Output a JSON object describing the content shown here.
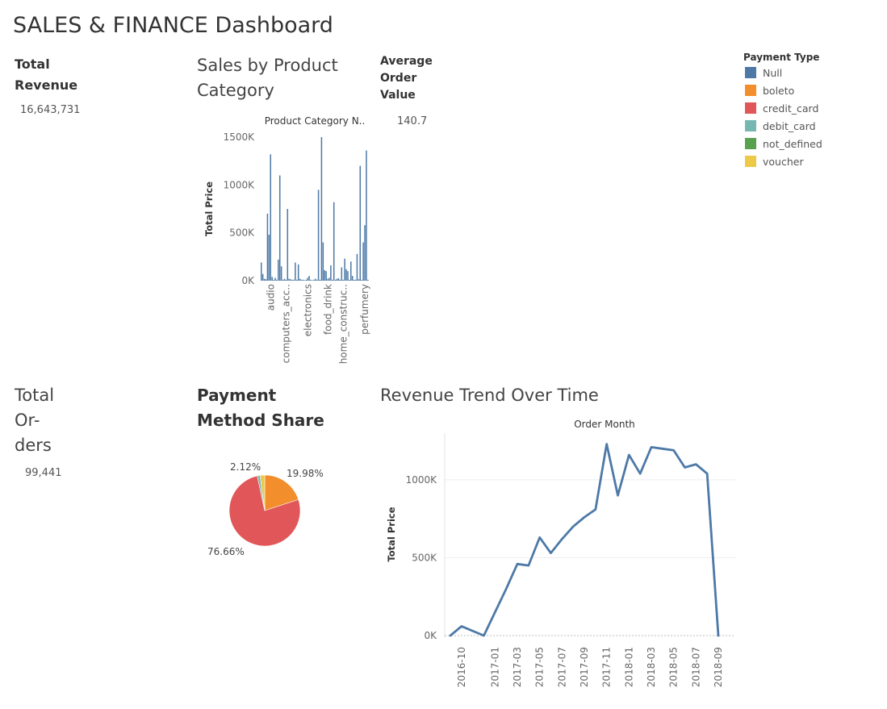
{
  "dashboard_title": "SALES & FINANCE Dashboard",
  "kpis": {
    "total_revenue": {
      "label_line1": "Total",
      "label_line2": "Revenue",
      "value": "16,643,731"
    },
    "average_order_value": {
      "label_line1": "Average",
      "label_line2": "Order",
      "label_line3": "Value",
      "value": "140.7"
    },
    "total_orders": {
      "label_line1": "Total",
      "label_line2": "Or-",
      "label_line3": "ders",
      "value": "99,441"
    }
  },
  "sections": {
    "sales_by_category": {
      "title_line1": "Sales by Product",
      "title_line2": "Category"
    },
    "payment_share": {
      "title_line1": "Payment",
      "title_line2": "Method Share"
    },
    "revenue_trend": {
      "title": "Revenue Trend Over Time"
    }
  },
  "legend": {
    "title": "Payment Type",
    "items": [
      {
        "label": "Null",
        "color": "#4e79a7"
      },
      {
        "label": "boleto",
        "color": "#f28e2b"
      },
      {
        "label": "credit_card",
        "color": "#e15759"
      },
      {
        "label": "debit_card",
        "color": "#76b7b2"
      },
      {
        "label": "not_defined",
        "color": "#59a14f"
      },
      {
        "label": "voucher",
        "color": "#edc948"
      }
    ]
  },
  "chart_data": [
    {
      "type": "bar",
      "title": "Product Category N..",
      "xlabel": "",
      "ylabel": "Total Price",
      "ylim": [
        0,
        1500000
      ],
      "yticks": [
        0,
        500000,
        1000000,
        1500000
      ],
      "ytick_labels": [
        "0K",
        "500K",
        "1000K",
        "1500K"
      ],
      "xtick_labels": [
        "audio",
        "computers_acc..",
        "electronics",
        "food_drink",
        "home_construc..",
        "perfumery"
      ],
      "xtick_indices": [
        6,
        16,
        30,
        43,
        53,
        67
      ],
      "color": "#4e79a7",
      "values": [
        190000,
        70000,
        20000,
        15000,
        700000,
        480000,
        1320000,
        40000,
        10000,
        30000,
        10000,
        220000,
        1100000,
        150000,
        10000,
        20000,
        10000,
        750000,
        20000,
        15000,
        10000,
        10000,
        190000,
        10000,
        170000,
        20000,
        10000,
        10000,
        5000,
        10000,
        30000,
        50000,
        10000,
        5000,
        10000,
        20000,
        10000,
        950000,
        10000,
        1500000,
        400000,
        110000,
        100000,
        20000,
        30000,
        160000,
        10000,
        820000,
        10000,
        20000,
        25000,
        10000,
        140000,
        10000,
        230000,
        120000,
        100000,
        10000,
        200000,
        50000,
        10000,
        10000,
        280000,
        15000,
        1200000,
        10000,
        400000,
        580000,
        1360000,
        10000
      ]
    },
    {
      "type": "pie",
      "labels": [
        "Null",
        "boleto",
        "credit_card",
        "debit_card",
        "not_defined",
        "voucher"
      ],
      "values": [
        0.0,
        19.98,
        76.66,
        1.24,
        0.0,
        2.12
      ],
      "colors": [
        "#4e79a7",
        "#f28e2b",
        "#e15759",
        "#76b7b2",
        "#59a14f",
        "#edc948"
      ],
      "data_labels": [
        {
          "text": "19.98%",
          "slice": "boleto"
        },
        {
          "text": "76.66%",
          "slice": "credit_card"
        },
        {
          "text": "2.12%",
          "slice": "voucher"
        }
      ]
    },
    {
      "type": "line",
      "title": "Order Month",
      "xlabel": "",
      "ylabel": "Total Price",
      "ylim": [
        0,
        1300000
      ],
      "yticks": [
        0,
        500000,
        1000000
      ],
      "ytick_labels": [
        "0K",
        "500K",
        "1000K"
      ],
      "x": [
        "2016-09",
        "2016-10",
        "2016-12",
        "2017-01",
        "2017-02",
        "2017-03",
        "2017-04",
        "2017-05",
        "2017-06",
        "2017-07",
        "2017-08",
        "2017-09",
        "2017-10",
        "2017-11",
        "2017-12",
        "2018-01",
        "2018-02",
        "2018-03",
        "2018-04",
        "2018-05",
        "2018-06",
        "2018-07",
        "2018-08",
        "2018-09"
      ],
      "xtick_labels": [
        "2016-10",
        "2017-01",
        "2017-03",
        "2017-05",
        "2017-07",
        "2017-09",
        "2017-11",
        "2018-01",
        "2018-03",
        "2018-05",
        "2018-07",
        "2018-09"
      ],
      "color": "#4e79a7",
      "values": [
        0,
        60000,
        0,
        150000,
        300000,
        460000,
        450000,
        630000,
        530000,
        620000,
        700000,
        760000,
        810000,
        1230000,
        900000,
        1160000,
        1040000,
        1210000,
        1200000,
        1190000,
        1080000,
        1100000,
        1040000,
        0
      ]
    }
  ]
}
